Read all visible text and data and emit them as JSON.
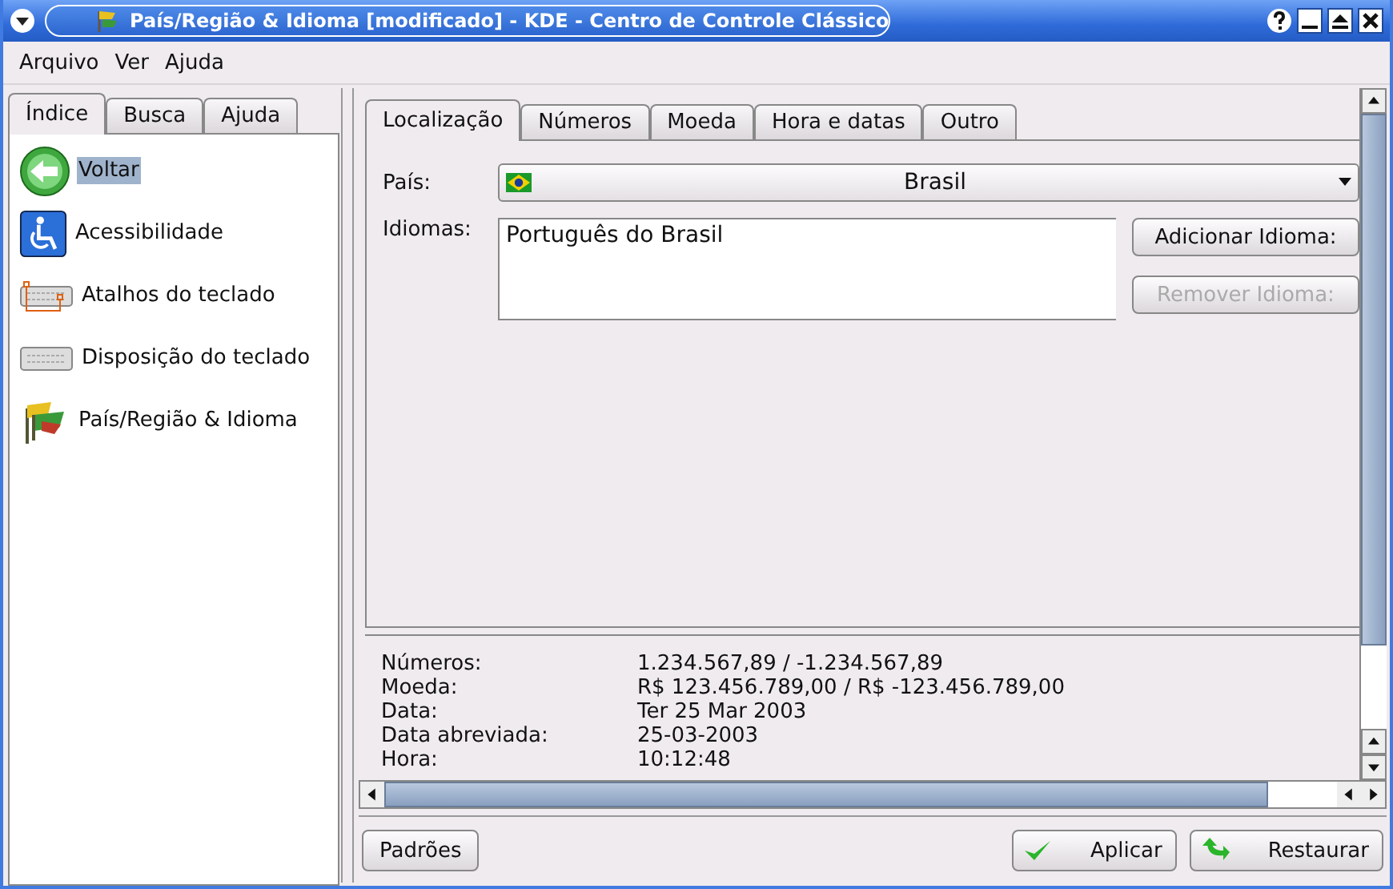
{
  "window": {
    "title": "País/Região & Idioma [modificado] - KDE - Centro de Controle Clássico"
  },
  "menu": [
    "Arquivo",
    "Ver",
    "Ajuda"
  ],
  "sidebar": {
    "tabs": [
      {
        "label": "Índice",
        "selected": true
      },
      {
        "label": "Busca",
        "selected": false
      },
      {
        "label": "Ajuda",
        "selected": false
      }
    ],
    "items": [
      {
        "label": "Voltar",
        "kind": "back",
        "selected": true
      },
      {
        "label": "Acessibilidade",
        "kind": "accessibility",
        "selected": false
      },
      {
        "label": "Atalhos do teclado",
        "kind": "shortcuts",
        "selected": false
      },
      {
        "label": "Disposição do teclado",
        "kind": "keyboard",
        "selected": false
      },
      {
        "label": "País/Região & Idioma",
        "kind": "flags",
        "selected": false
      }
    ]
  },
  "tabs": [
    {
      "label": "Localização",
      "selected": true
    },
    {
      "label": "Números",
      "selected": false
    },
    {
      "label": "Moeda",
      "selected": false
    },
    {
      "label": "Hora e datas",
      "selected": false
    },
    {
      "label": "Outro",
      "selected": false
    }
  ],
  "country": {
    "label": "País:",
    "value": "Brasil"
  },
  "languages": {
    "label": "Idiomas:",
    "items": [
      "Português do Brasil"
    ],
    "add_button": {
      "label": "Adicionar Idioma:",
      "disabled": false
    },
    "remove_button": {
      "label": "Remover Idioma:",
      "disabled": true
    }
  },
  "preview": [
    {
      "label": "Números:",
      "value": "1.234.567,89 / -1.234.567,89"
    },
    {
      "label": "Moeda:",
      "value": "R$ 123.456.789,00 / R$ -123.456.789,00"
    },
    {
      "label": "Data:",
      "value": "Ter 25 Mar 2003"
    },
    {
      "label": "Data abreviada:",
      "value": "25-03-2003"
    },
    {
      "label": "Hora:",
      "value": "10:12:48"
    }
  ],
  "buttons": [
    {
      "label": "Padrões",
      "kind": "plain"
    },
    {
      "label": "Aplicar",
      "kind": "apply"
    },
    {
      "label": "Restaurar",
      "kind": "reset"
    }
  ]
}
